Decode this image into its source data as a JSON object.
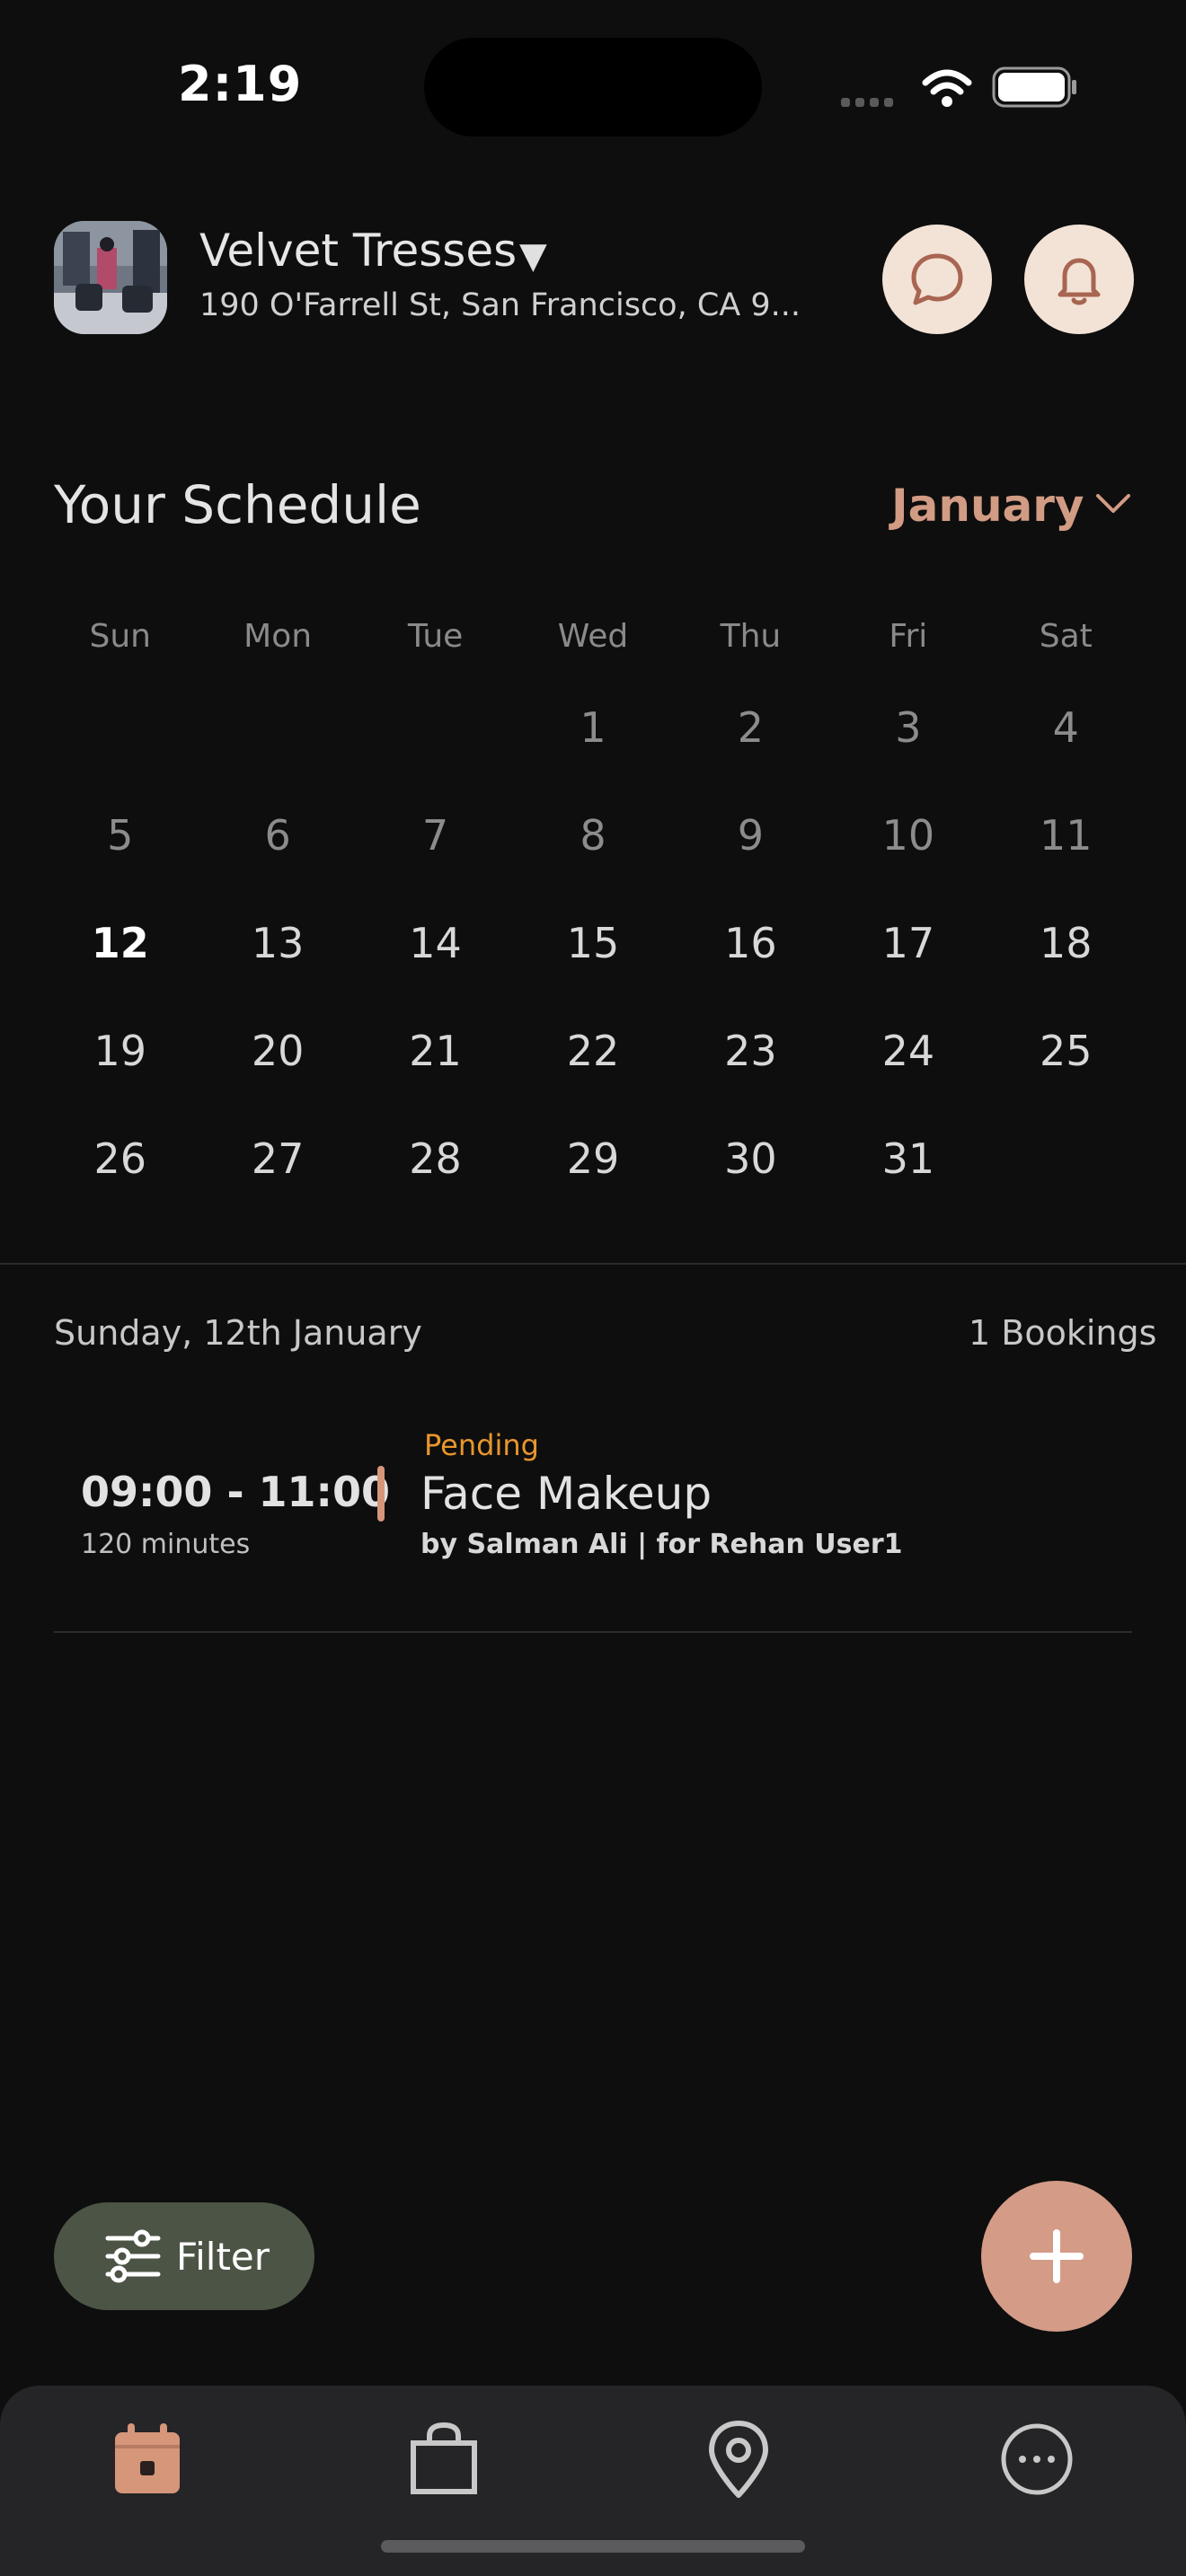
{
  "status_bar": {
    "time": "2:19"
  },
  "header": {
    "shop_name": "Velvet Tresses",
    "shop_caret": "▼",
    "address": "190 O'Farrell St, San Francisco, CA 9...",
    "chat_icon": "chat-bubble-icon",
    "bell_icon": "bell-icon"
  },
  "schedule": {
    "title": "Your Schedule",
    "month": "January",
    "weekdays": [
      "Sun",
      "Mon",
      "Tue",
      "Wed",
      "Thu",
      "Fri",
      "Sat"
    ],
    "weeks": [
      [
        "",
        "",
        "",
        "1",
        "2",
        "3",
        "4"
      ],
      [
        "5",
        "6",
        "7",
        "8",
        "9",
        "10",
        "11"
      ],
      [
        "12",
        "13",
        "14",
        "15",
        "16",
        "17",
        "18"
      ],
      [
        "19",
        "20",
        "21",
        "22",
        "23",
        "24",
        "25"
      ],
      [
        "26",
        "27",
        "28",
        "29",
        "30",
        "31",
        ""
      ]
    ],
    "selected_day": "12"
  },
  "day_summary": {
    "label": "Sunday, 12th January",
    "bookings": "1 Bookings"
  },
  "booking": {
    "status": "Pending",
    "time": "09:00 - 11:00",
    "duration": "120 minutes",
    "title": "Face Makeup",
    "by": "by Salman Ali | for Rehan  User1"
  },
  "filter": {
    "label": "Filter",
    "icon": "sliders-icon"
  },
  "fab": {
    "icon": "plus-icon"
  },
  "nav": {
    "items": [
      "calendar-icon",
      "shopping-bag-icon",
      "location-pin-icon",
      "more-icon"
    ]
  },
  "colors": {
    "accent": "#d29b84",
    "pending": "#e8962c",
    "background": "#0e0e0e",
    "filter": "#4c5445"
  }
}
